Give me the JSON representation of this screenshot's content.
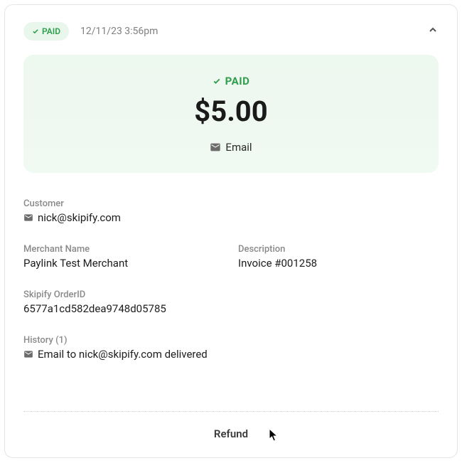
{
  "header": {
    "status_label": "PAID",
    "timestamp": "12/11/23 3:56pm"
  },
  "summary": {
    "status_label": "PAID",
    "amount": "$5.00",
    "email_action": "Email"
  },
  "customer": {
    "label": "Customer",
    "email": "nick@skipify.com"
  },
  "merchant": {
    "label": "Merchant Name",
    "value": "Paylink Test Merchant"
  },
  "description": {
    "label": "Description",
    "value": "Invoice #001258"
  },
  "order": {
    "label": "Skipify OrderID",
    "value": "6577a1cd582dea9748d05785"
  },
  "history": {
    "label": "History (1)",
    "entry": "Email to nick@skipify.com delivered"
  },
  "actions": {
    "refund": "Refund"
  }
}
